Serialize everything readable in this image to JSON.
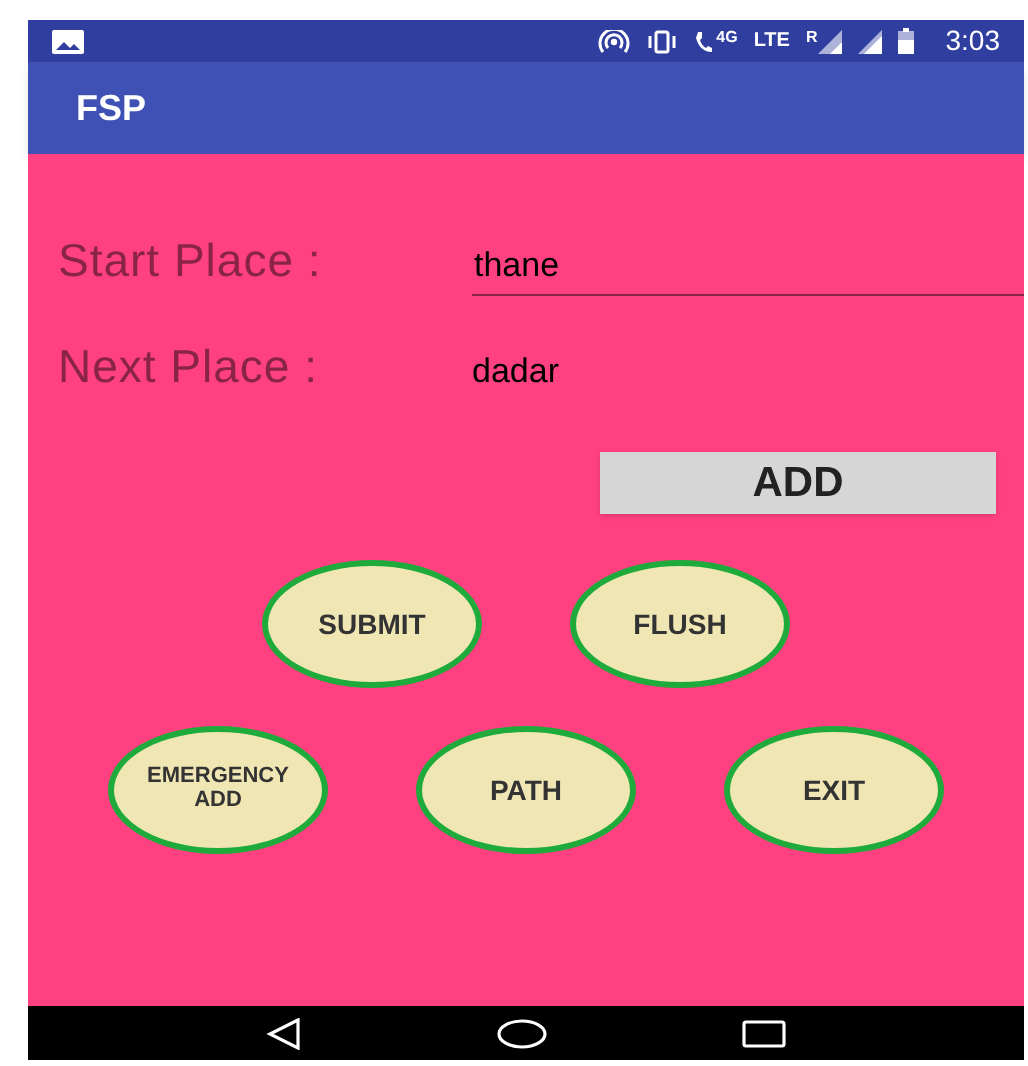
{
  "status_bar": {
    "call_label": "4G",
    "network": "LTE",
    "roaming": "R",
    "time": "3:03"
  },
  "app_bar": {
    "title": "FSP"
  },
  "fields": [
    {
      "label": "Start Place :",
      "value": "thane",
      "underlined": true
    },
    {
      "label": "Next Place :",
      "value": "dadar",
      "underlined": false
    }
  ],
  "add_button": "ADD",
  "button_rows": [
    [
      "SUBMIT",
      "FLUSH"
    ],
    [
      "EMERGENCY ADD",
      "PATH",
      "EXIT"
    ]
  ]
}
